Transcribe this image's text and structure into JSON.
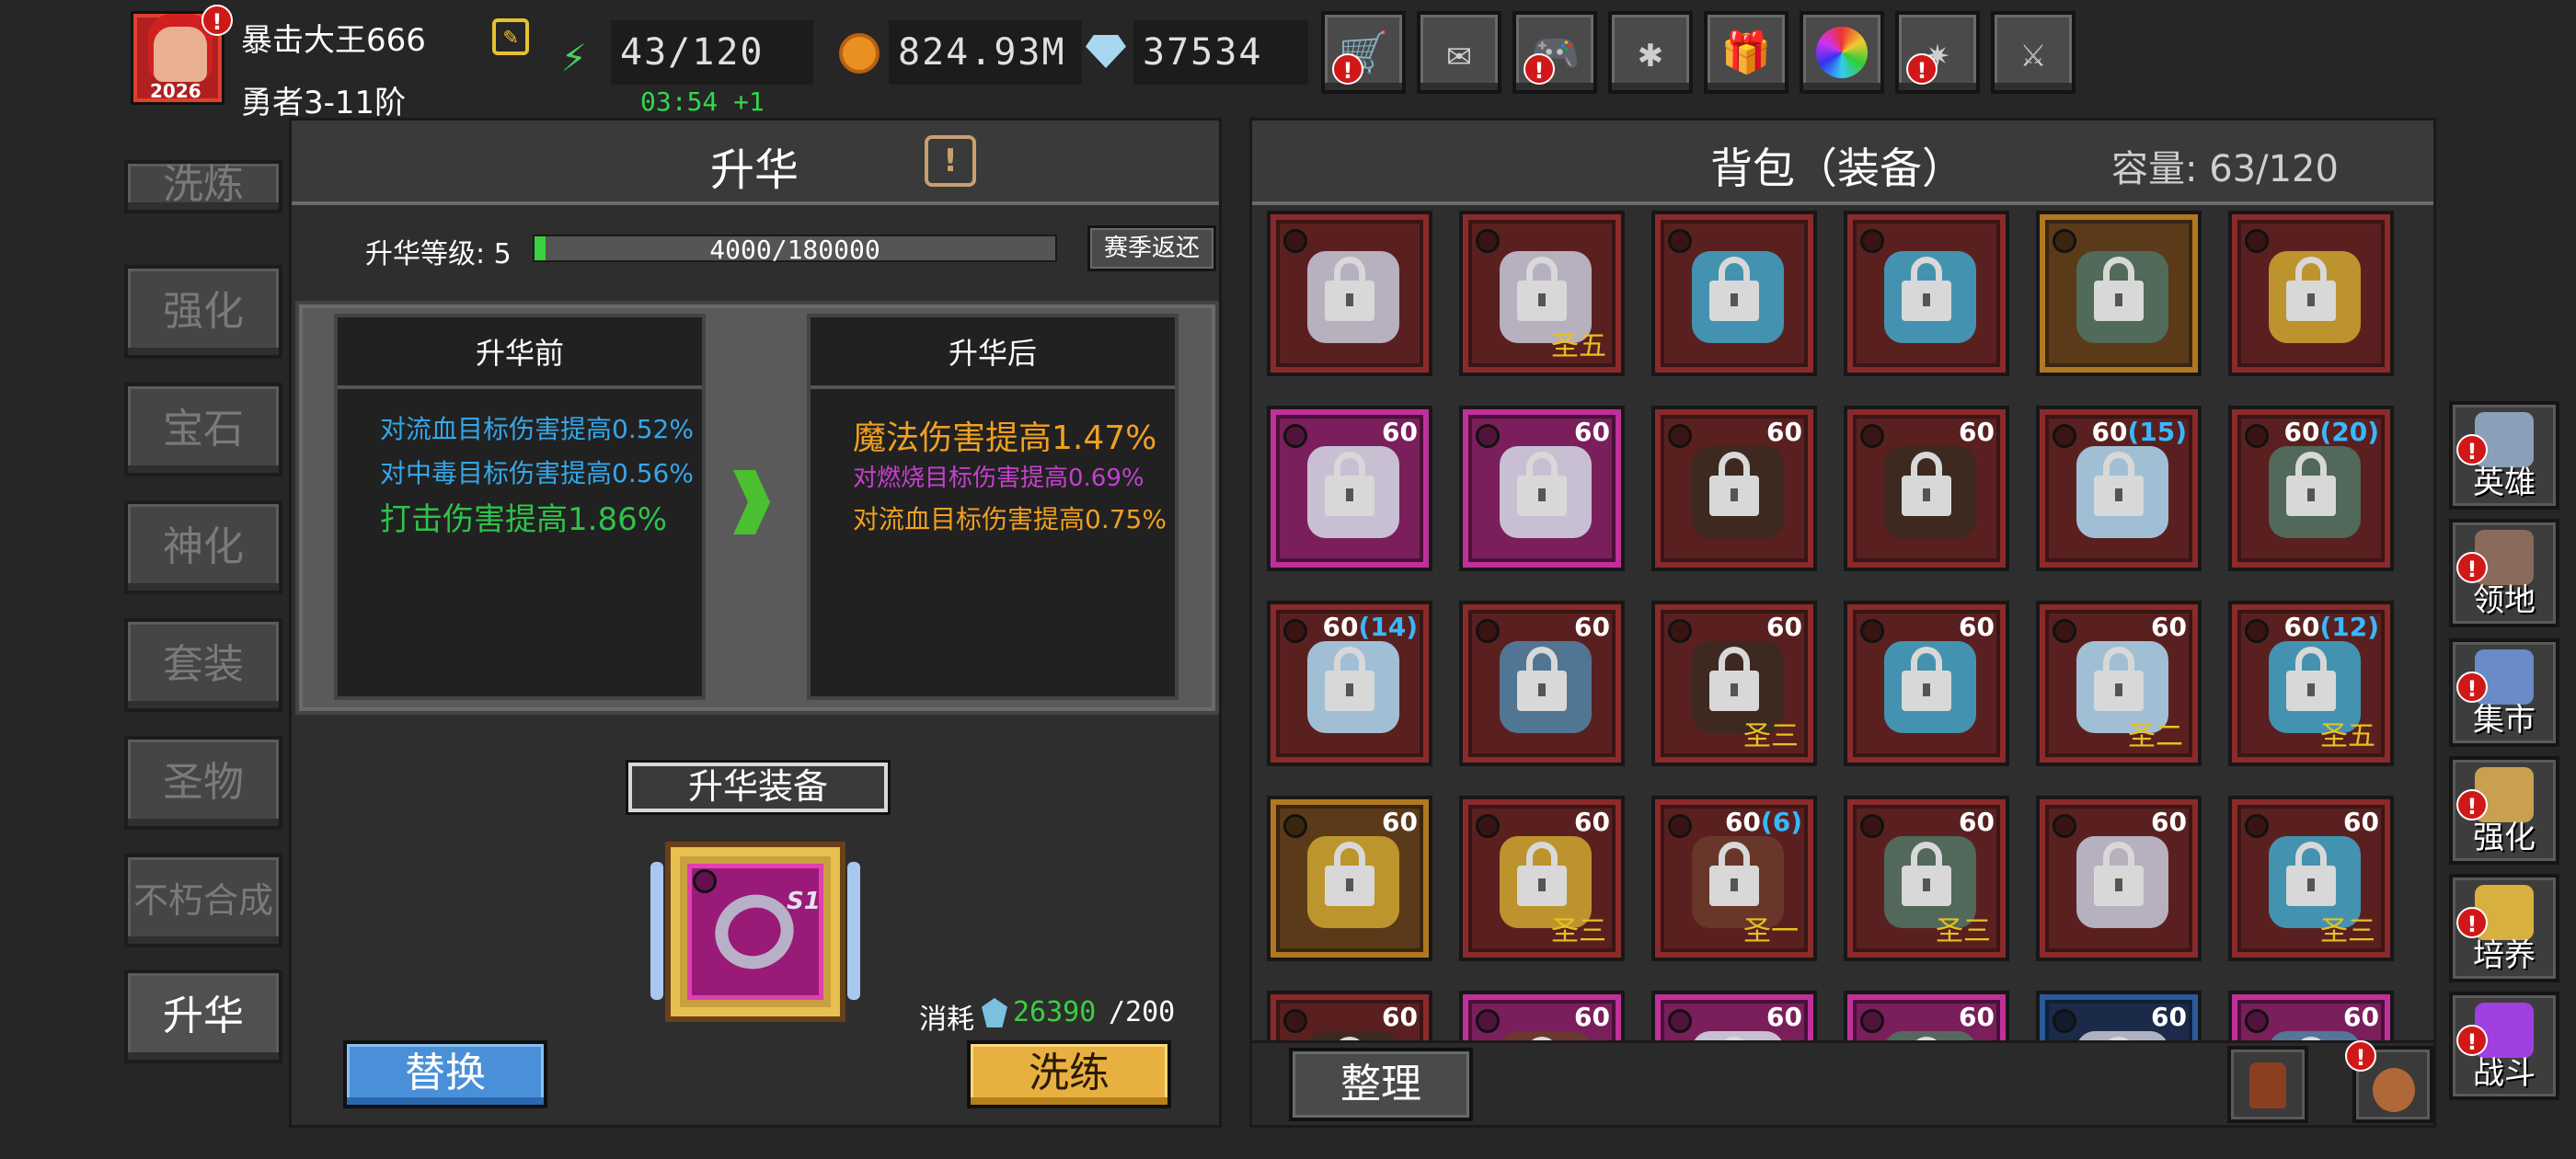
{
  "player": {
    "name": "暴击大王666",
    "rank": "勇者3-11阶",
    "avatar_badge": "2026"
  },
  "resources": {
    "energy": "43/120",
    "energy_timer": "03:54 +1",
    "gold": "824.93M",
    "gems": "37534"
  },
  "top_icons": [
    "cart-icon",
    "mail-icon",
    "gamepad-icon",
    "gear-icon",
    "gift-icon",
    "color-wheel-icon",
    "sparkle-icon",
    "crossed-swords-icon"
  ],
  "side_tabs": [
    "洗炼",
    "强化",
    "宝石",
    "神化",
    "套装",
    "圣物",
    "不朽合成",
    "升华"
  ],
  "sublimation": {
    "title": "升华",
    "level_label": "升华等级: 5",
    "progress_text": "4000/180000",
    "progress": 0.022,
    "season_return": "赛季返还",
    "before_title": "升华前",
    "after_title": "升华后",
    "before_stats": [
      {
        "text": "对流血目标伤害提高0.52%",
        "color": "#35a7e8"
      },
      {
        "text": "对中毒目标伤害提高0.56%",
        "color": "#35a7e8"
      },
      {
        "text": "打击伤害提高1.86%",
        "color": "#2ec24a"
      }
    ],
    "after_stats": [
      {
        "text": "魔法伤害提高1.47%",
        "color": "#f0a020"
      },
      {
        "text": "对燃烧目标伤害提高0.69%",
        "color": "#c540d0"
      },
      {
        "text": "对流血目标伤害提高0.75%",
        "color": "#f0a020"
      }
    ],
    "equip_label": "升华装备",
    "equip_tag": "S1",
    "cost_label": "消耗",
    "cost_have": "26390",
    "cost_need": "/200",
    "replace_btn": "替换",
    "refine_btn": "洗练"
  },
  "bag": {
    "title": "背包（装备）",
    "capacity": "容量: 63/120",
    "sort_btn": "整理",
    "rows": [
      [
        {
          "c": "red",
          "l": "",
          "s": "",
          "ic": "helm"
        },
        {
          "c": "red",
          "l": "",
          "s": "圣五",
          "ic": "helm"
        },
        {
          "c": "red",
          "l": "",
          "s": "",
          "ic": "crown"
        },
        {
          "c": "red",
          "l": "",
          "s": "",
          "ic": "crown"
        },
        {
          "c": "gold",
          "l": "",
          "s": "",
          "ic": "bow"
        },
        {
          "c": "red",
          "l": "",
          "s": "",
          "ic": "staff"
        }
      ],
      [
        {
          "c": "pink",
          "l": "60",
          "b": "",
          "s": "",
          "ic": "armor"
        },
        {
          "c": "pink",
          "l": "60",
          "b": "",
          "s": "",
          "ic": "armor"
        },
        {
          "c": "red",
          "l": "60",
          "b": "",
          "s": "",
          "ic": "glove"
        },
        {
          "c": "red",
          "l": "60",
          "b": "",
          "s": "",
          "ic": "glove"
        },
        {
          "c": "red",
          "l": "60",
          "b": "(15)",
          "s": "",
          "ic": "sword"
        },
        {
          "c": "red",
          "l": "60",
          "b": "(20)",
          "s": "",
          "ic": "bow"
        }
      ],
      [
        {
          "c": "red",
          "l": "60",
          "b": "(14)",
          "s": "",
          "ic": "sword"
        },
        {
          "c": "red",
          "l": "60",
          "b": "",
          "s": "",
          "ic": "amulet"
        },
        {
          "c": "red",
          "l": "60",
          "b": "",
          "s": "圣三",
          "ic": "glove"
        },
        {
          "c": "red",
          "l": "60",
          "b": "",
          "s": "",
          "ic": "crown"
        },
        {
          "c": "red",
          "l": "60",
          "b": "",
          "s": "圣二",
          "ic": "sword"
        },
        {
          "c": "red",
          "l": "60",
          "b": "(12)",
          "s": "圣五",
          "ic": "crown"
        }
      ],
      [
        {
          "c": "gold",
          "l": "60",
          "b": "",
          "s": "",
          "ic": "staff"
        },
        {
          "c": "red",
          "l": "60",
          "b": "",
          "s": "圣三",
          "ic": "staff"
        },
        {
          "c": "red",
          "l": "60",
          "b": "(6)",
          "s": "圣一",
          "ic": "boots"
        },
        {
          "c": "red",
          "l": "60",
          "b": "",
          "s": "圣三",
          "ic": "bow"
        },
        {
          "c": "red",
          "l": "60",
          "b": "",
          "s": "",
          "ic": "helm"
        },
        {
          "c": "red",
          "l": "60",
          "b": "",
          "s": "圣三",
          "ic": "crown"
        }
      ],
      [
        {
          "c": "red",
          "l": "60",
          "b": "",
          "s": "",
          "ic": "glove"
        },
        {
          "c": "pink",
          "l": "60",
          "b": "",
          "s": "",
          "ic": "boots"
        },
        {
          "c": "pink",
          "l": "60",
          "b": "",
          "s": "",
          "ic": "armor"
        },
        {
          "c": "pink",
          "l": "60",
          "b": "",
          "s": "",
          "ic": "bow"
        },
        {
          "c": "blue",
          "l": "60",
          "b": "",
          "s": "",
          "ic": "helm"
        },
        {
          "c": "pink",
          "l": "60",
          "b": "",
          "s": "",
          "ic": "amulet"
        }
      ]
    ]
  },
  "right_nav": [
    {
      "label": "英雄",
      "icon": "helmet-icon",
      "color": "#8aa0b8"
    },
    {
      "label": "领地",
      "icon": "castle-icon",
      "color": "#8a6a5a"
    },
    {
      "label": "集市",
      "icon": "market-icon",
      "color": "#6a8ac8"
    },
    {
      "label": "强化",
      "icon": "enhance-icon",
      "color": "#c8a050"
    },
    {
      "label": "培养",
      "icon": "chalice-icon",
      "color": "#d8b040"
    },
    {
      "label": "战斗",
      "icon": "portal-icon",
      "color": "#a040e0"
    }
  ]
}
